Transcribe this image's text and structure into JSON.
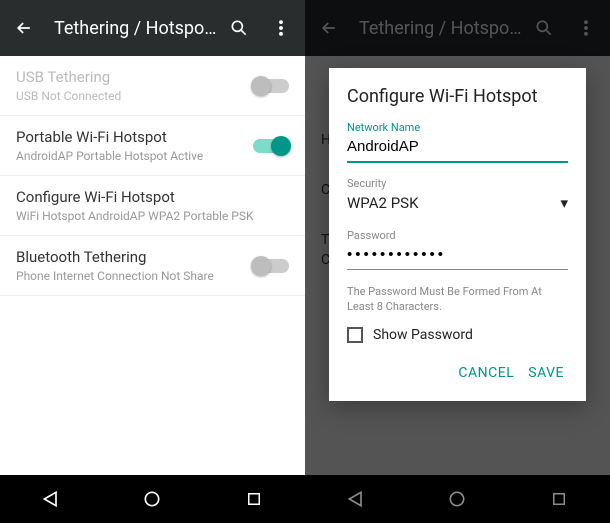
{
  "left": {
    "title": "Tethering / Hotspot P...",
    "rows": [
      {
        "primary": "USB Tethering",
        "secondary": "USB Not Connected",
        "disabled": true,
        "toggle": false
      },
      {
        "primary": "Portable Wi-Fi Hotspot",
        "secondary": "AndroidAP Portable Hotspot Active",
        "disabled": false,
        "toggle": true
      },
      {
        "primary": "Configure Wi-Fi Hotspot",
        "secondary": "WiFi Hotspot AndroidAP WPA2 Portable PSK",
        "disabled": false,
        "toggle": null
      },
      {
        "primary": "Bluetooth Tethering",
        "secondary": "Phone Internet Connection Not Share",
        "disabled": false,
        "toggle": false
      }
    ]
  },
  "right": {
    "title": "Tethering / Hotspot P...",
    "bg_fragments": [
      "H",
      "C",
      "T",
      "C"
    ],
    "dialog": {
      "heading": "Configure Wi-Fi Hotspot",
      "network_label": "Network Name",
      "network_value": "AndroidAP",
      "security_label": "Security",
      "security_value": "WPA2 PSK",
      "password_label": "Password",
      "password_value": "••••••••••••",
      "hint": "The Password Must Be Formed From At Least 8 Characters.",
      "show_password": "Show Password",
      "cancel": "CANCEL",
      "save": "SAVE"
    }
  }
}
